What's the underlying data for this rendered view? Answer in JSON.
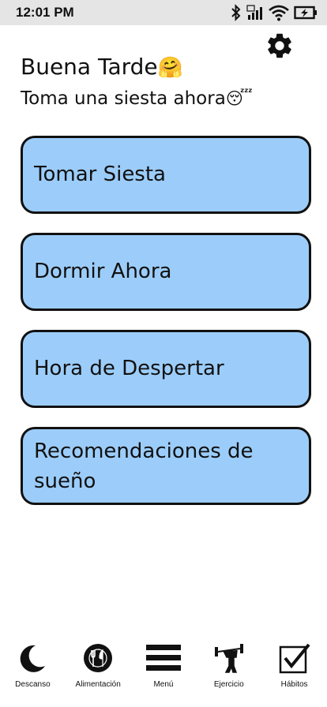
{
  "status_bar": {
    "time": "12:01 PM",
    "icons": [
      "bluetooth-icon",
      "signal-icon",
      "wifi-icon",
      "battery-charging-icon"
    ]
  },
  "header": {
    "settings_icon": "gear-icon",
    "greeting": "Buena Tarde",
    "greeting_emoji": "🤗",
    "subtitle": "Toma una siesta ahora",
    "subtitle_emoji": "😴"
  },
  "actions": [
    {
      "label": "Tomar Siesta"
    },
    {
      "label": "Dormir Ahora"
    },
    {
      "label": "Hora de Despertar"
    },
    {
      "label": "Recomendaciones de sueño"
    }
  ],
  "colors": {
    "button_bg": "#9ccdfa",
    "button_border": "#111111",
    "status_bar_bg": "#e5e5e5"
  },
  "bottom_nav": [
    {
      "label": "Descanso",
      "icon": "moon-icon"
    },
    {
      "label": "Alimentación",
      "icon": "plate-utensils-icon"
    },
    {
      "label": "Menú",
      "icon": "menu-icon"
    },
    {
      "label": "Ejercicio",
      "icon": "weightlifter-icon"
    },
    {
      "label": "Hábitos",
      "icon": "checkbox-icon"
    }
  ]
}
